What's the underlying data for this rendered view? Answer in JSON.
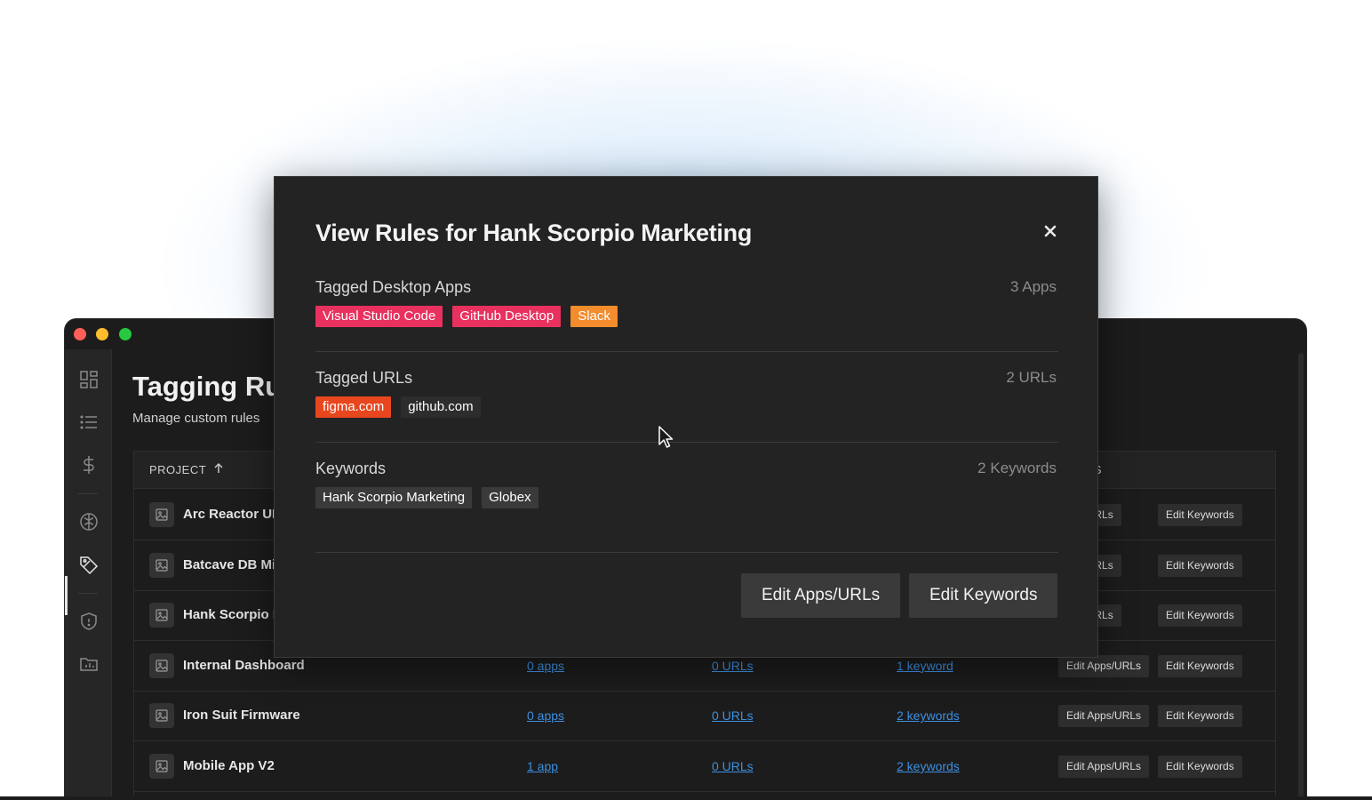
{
  "window": {
    "title": "Tagging Rul",
    "subtitle": "Manage custom rules",
    "sidebar": {
      "icons": [
        "dashboard-icon",
        "list-icon",
        "dollar-icon",
        "brain-icon",
        "tag-icon",
        "shield-icon",
        "folder-chart-icon"
      ]
    }
  },
  "table": {
    "headers": {
      "project": "PROJECT",
      "actions": "NS"
    },
    "rows": [
      {
        "name": "Arc Reactor UI",
        "apps": "",
        "urls": "",
        "keywords": "",
        "edit_apps": "pps/URLs",
        "edit_keywords": "Edit Keywords"
      },
      {
        "name": "Batcave DB Mi",
        "apps": "",
        "urls": "",
        "keywords": "",
        "edit_apps": "pps/URLs",
        "edit_keywords": "Edit Keywords"
      },
      {
        "name": "Hank Scorpio I",
        "apps": "",
        "urls": "",
        "keywords": "",
        "edit_apps": "pps/URLs",
        "edit_keywords": "Edit Keywords"
      },
      {
        "name": "Internal Dashboard",
        "apps": "0 apps",
        "urls": "0 URLs",
        "keywords": "1 keyword",
        "edit_apps": "Edit Apps/URLs",
        "edit_keywords": "Edit Keywords"
      },
      {
        "name": "Iron Suit Firmware",
        "apps": "0 apps",
        "urls": "0 URLs",
        "keywords": "2 keywords",
        "edit_apps": "Edit Apps/URLs",
        "edit_keywords": "Edit Keywords"
      },
      {
        "name": "Mobile App V2",
        "apps": "1 app",
        "urls": "0 URLs",
        "keywords": "2 keywords",
        "edit_apps": "Edit Apps/URLs",
        "edit_keywords": "Edit Keywords"
      }
    ]
  },
  "modal": {
    "title": "View Rules for Hank Scorpio Marketing",
    "sections": {
      "apps": {
        "title": "Tagged Desktop Apps",
        "count": "3 Apps",
        "tags": [
          {
            "label": "Visual Studio Code",
            "color": "#e8315f"
          },
          {
            "label": "GitHub Desktop",
            "color": "#e8315f"
          },
          {
            "label": "Slack",
            "color": "#f28c2c"
          }
        ]
      },
      "urls": {
        "title": "Tagged URLs",
        "count": "2 URLs",
        "tags": [
          {
            "label": "figma.com",
            "color": "#e8461e"
          },
          {
            "label": "github.com",
            "color": "#2d2d2d"
          }
        ]
      },
      "keywords": {
        "title": "Keywords",
        "count": "2 Keywords",
        "tags": [
          {
            "label": "Hank Scorpio Marketing",
            "color": "#3a3a3a"
          },
          {
            "label": "Globex",
            "color": "#3a3a3a"
          }
        ]
      }
    },
    "buttons": {
      "edit_apps": "Edit Apps/URLs",
      "edit_keywords": "Edit Keywords"
    }
  }
}
